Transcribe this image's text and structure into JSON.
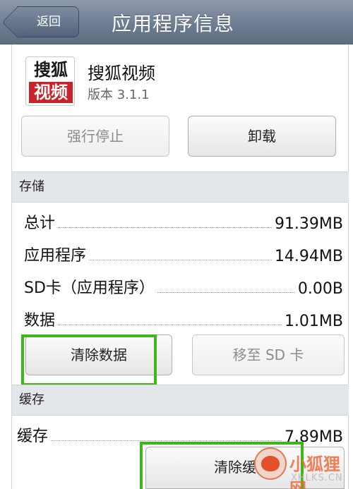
{
  "header": {
    "back_label": "返回",
    "title": "应用程序信息"
  },
  "app": {
    "icon_text_top": "搜狐",
    "icon_text_bottom": "视频",
    "name": "搜狐视频",
    "version": "版本 3.1.1"
  },
  "actions": {
    "force_stop": "强行停止",
    "uninstall": "卸载"
  },
  "storage": {
    "header": "存储",
    "rows": [
      {
        "label": "总计",
        "value": "91.39MB"
      },
      {
        "label": "应用程序",
        "value": "14.94MB"
      },
      {
        "label": "SD卡（应用程序）",
        "value": "0.00B"
      },
      {
        "label": "数据",
        "value": "1.01MB"
      }
    ],
    "clear_data": "清除数据",
    "move_to_sd": "移至 SD 卡"
  },
  "cache": {
    "header": "缓存",
    "label": "缓存",
    "value": "7.89MB",
    "clear_cache": "清除缓"
  },
  "watermark": {
    "text": "小狐狸网",
    "sub": "XHLKS.CN"
  },
  "colors": {
    "title_bar": "#6f7d92",
    "highlight": "#3fb619",
    "icon_red": "#c9222a"
  }
}
